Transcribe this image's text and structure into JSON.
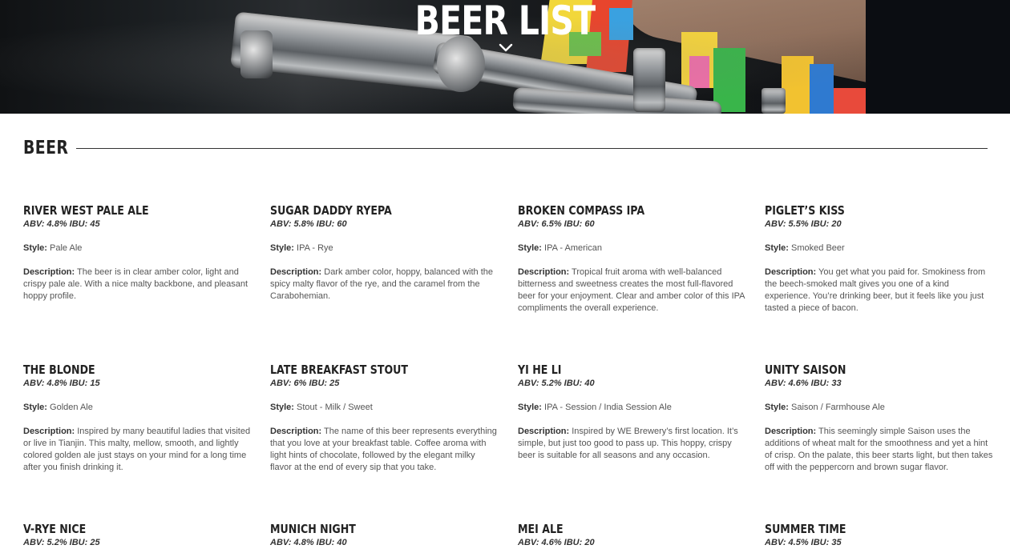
{
  "hero": {
    "title": "BEER LIST"
  },
  "section": {
    "title": "BEER"
  },
  "labels": {
    "style": "Style:",
    "description": "Description:"
  },
  "beers": [
    {
      "name": "RIVER WEST PALE ALE",
      "meta": "ABV: 4.8% IBU: 45",
      "style": "Pale Ale",
      "description": "The beer is in clear amber color, light and crispy pale ale. With a nice malty backbone, and pleasant hoppy profile."
    },
    {
      "name": "SUGAR DADDY RYEPA",
      "meta": "ABV: 5.8% IBU: 60",
      "style": "IPA - Rye",
      "description": "Dark amber color, hoppy, balanced with the spicy malty flavor of the rye, and the caramel from the Carabohemian."
    },
    {
      "name": "BROKEN COMPASS IPA",
      "meta": "ABV: 6.5% IBU: 60",
      "style": "IPA - American",
      "description": "Tropical fruit aroma with well-balanced bitterness and sweetness creates the most full-flavored beer for your enjoyment. Clear and amber color of this IPA compliments the overall experience."
    },
    {
      "name": "PIGLET’S KISS",
      "meta": "ABV: 5.5% IBU: 20",
      "style": "Smoked Beer",
      "description": "You get what you paid for. Smokiness from the beech-smoked malt gives you one of a kind experience. You’re drinking beer, but it feels like you just tasted a piece of bacon."
    },
    {
      "name": "THE BLONDE",
      "meta": "ABV: 4.8% IBU: 15",
      "style": "Golden Ale",
      "description": "Inspired by many beautiful ladies that visited or live in Tianjin. This malty, mellow, smooth, and lightly colored golden ale just stays on your mind for a long time after you finish drinking it."
    },
    {
      "name": "LATE BREAKFAST STOUT",
      "meta": "ABV: 6% IBU: 25",
      "style": "Stout - Milk / Sweet",
      "description": "The name of this beer represents everything that you love at your breakfast table. Coffee aroma with light hints of chocolate, followed by the elegant milky flavor at the end of every sip that you take."
    },
    {
      "name": "YI HE LI",
      "meta": "ABV: 5.2% IBU: 40",
      "style": "IPA - Session / India Session Ale",
      "description": "Inspired by WE Brewery’s first location. It’s simple, but just too good to pass up. This hoppy, crispy beer is suitable for all seasons and any occasion."
    },
    {
      "name": "UNITY SAISON",
      "meta": "ABV: 4.6% IBU: 33",
      "style": "Saison / Farmhouse Ale",
      "description": "This seemingly simple Saison uses the additions of wheat malt for the smoothness and yet a hint of crisp. On the palate, this beer starts light, but then takes off with the peppercorn and brown sugar flavor."
    },
    {
      "name": "V-RYE NICE",
      "meta": "ABV: 5.2% IBU: 25",
      "style": "",
      "description": ""
    },
    {
      "name": "MUNICH NIGHT",
      "meta": "ABV: 4.8% IBU: 40",
      "style": "",
      "description": ""
    },
    {
      "name": "MEI ALE",
      "meta": "ABV: 4.6% IBU: 20",
      "style": "",
      "description": ""
    },
    {
      "name": "SUMMER TIME",
      "meta": "ABV: 4.5% IBU: 35",
      "style": "",
      "description": ""
    }
  ]
}
